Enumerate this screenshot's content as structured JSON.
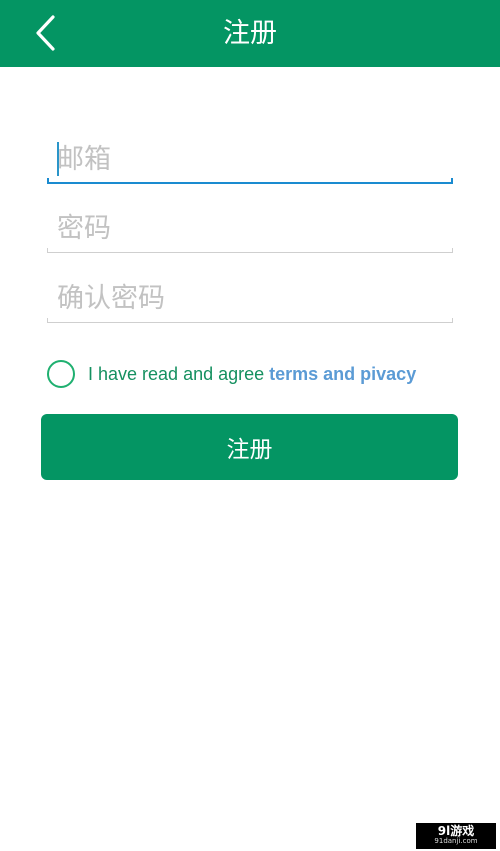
{
  "theme": {
    "brand": "#049563",
    "focus_line": "#1a8bd0",
    "link": "#5b9bd5",
    "radio": "#1fb070"
  },
  "header": {
    "title": "注册",
    "back_icon": "chevron-left-icon"
  },
  "form": {
    "email_placeholder": "邮箱",
    "password_placeholder": "密码",
    "confirm_placeholder": "确认密码",
    "email_value": "",
    "password_value": "",
    "confirm_value": ""
  },
  "agree": {
    "text": "I have read and agree",
    "link": "terms and pivacy",
    "checked": false
  },
  "submit_label": "注册",
  "watermark": {
    "main": "9l游戏",
    "sub": "91danji.com"
  }
}
